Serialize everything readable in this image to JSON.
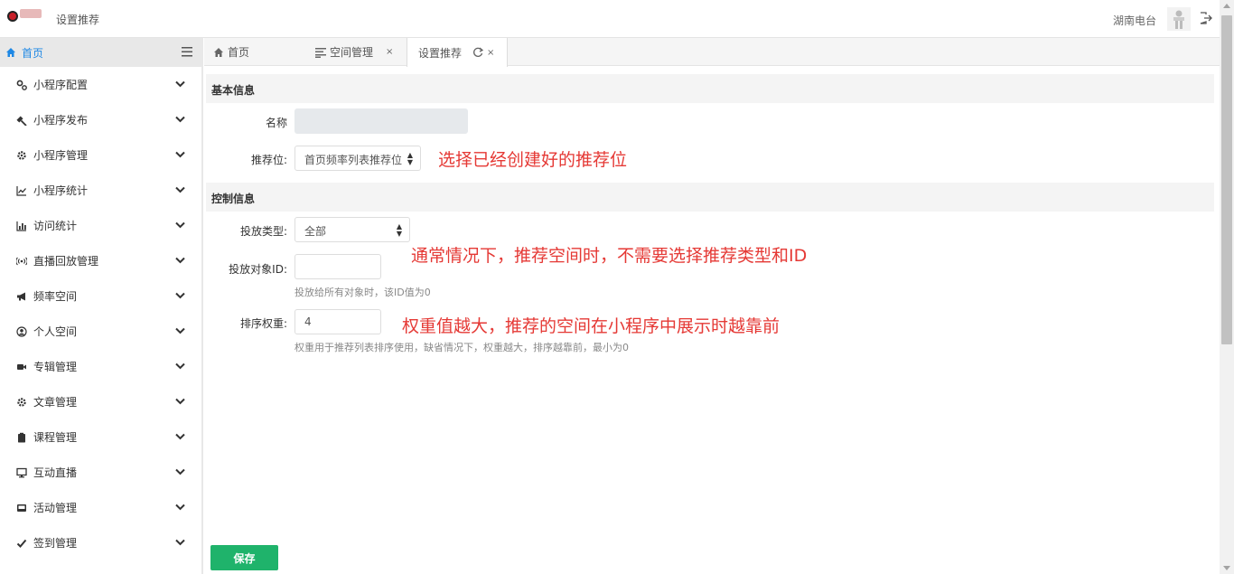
{
  "header": {
    "page_title": "设置推荐",
    "user_name": "湖南电台"
  },
  "sidebar": {
    "home_label": "首页",
    "items": [
      {
        "label": "小程序配置",
        "icon": "gears-icon"
      },
      {
        "label": "小程序发布",
        "icon": "gavel-icon"
      },
      {
        "label": "小程序管理",
        "icon": "gear-icon"
      },
      {
        "label": "小程序统计",
        "icon": "line-chart-icon"
      },
      {
        "label": "访问统计",
        "icon": "bar-chart-icon"
      },
      {
        "label": "直播回放管理",
        "icon": "broadcast-icon"
      },
      {
        "label": "频率空间",
        "icon": "megaphone-icon"
      },
      {
        "label": "个人空间",
        "icon": "user-circle-icon"
      },
      {
        "label": "专辑管理",
        "icon": "video-camera-icon"
      },
      {
        "label": "文章管理",
        "icon": "gear-icon"
      },
      {
        "label": "课程管理",
        "icon": "clipboard-icon"
      },
      {
        "label": "互动直播",
        "icon": "monitor-icon"
      },
      {
        "label": "活动管理",
        "icon": "inbox-icon"
      },
      {
        "label": "签到管理",
        "icon": "check-icon"
      }
    ]
  },
  "tabs": [
    {
      "label": "首页",
      "icon": "home-icon"
    },
    {
      "label": "空间管理",
      "icon": "list-icon",
      "close": "×"
    },
    {
      "label": "设置推荐",
      "icon": "refresh-icon",
      "close": "×"
    }
  ],
  "form": {
    "section_basic": "基本信息",
    "name_label": "名称",
    "name_value": "",
    "position_label": "推荐位:",
    "position_value": "首页频率列表推荐位",
    "section_control": "控制信息",
    "type_label": "投放类型:",
    "type_value": "全部",
    "target_label": "投放对象ID:",
    "target_value": "",
    "target_help": "投放给所有对象时，该ID值为0",
    "weight_label": "排序权重:",
    "weight_value": "4",
    "weight_help": "权重用于推荐列表排序使用，缺省情况下，权重越大，排序越靠前，最小为0",
    "save_label": "保存"
  },
  "annotations": {
    "position_note": "选择已经创建好的推荐位",
    "type_note": "通常情况下，推荐空间时，不需要选择推荐类型和ID",
    "weight_note": "权重值越大，推荐的空间在小程序中展示时越靠前"
  },
  "colors": {
    "accent_blue": "#1e88e5",
    "save_green": "#1fb36b",
    "note_red": "#e53935"
  }
}
